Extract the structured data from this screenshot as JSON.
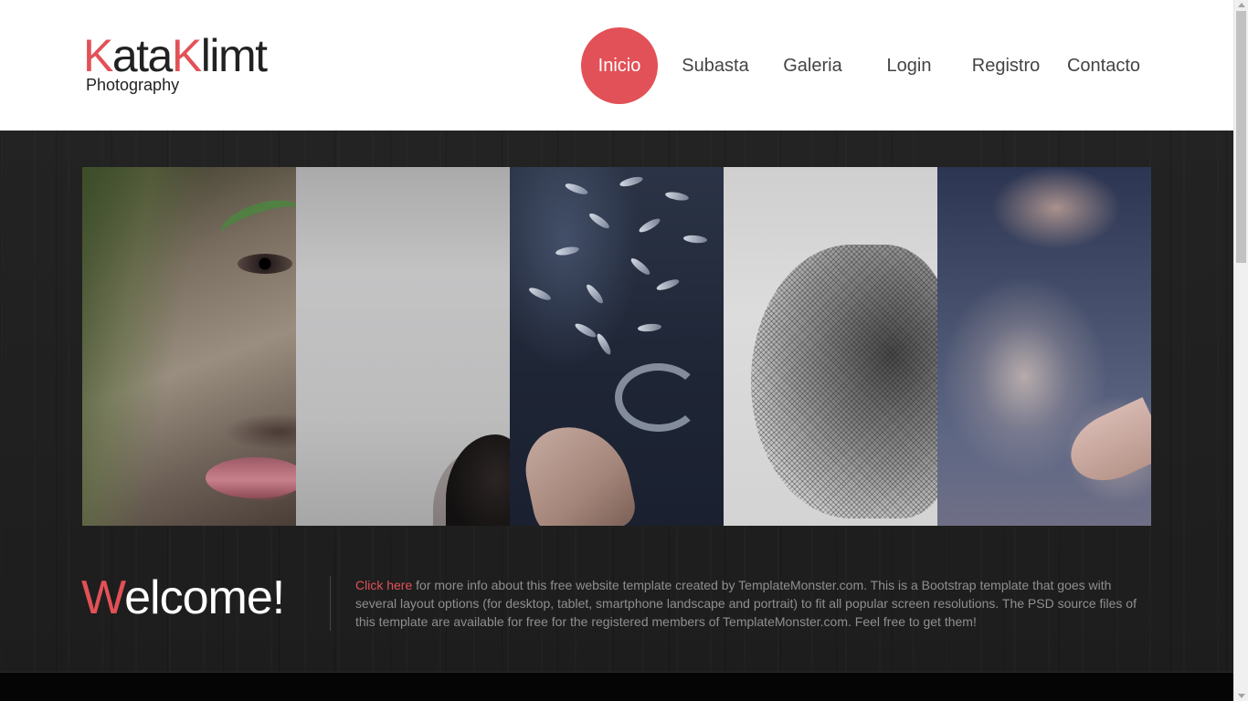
{
  "logo": {
    "first_initial": "K",
    "first_rest": "ata",
    "second_initial": "K",
    "second_rest": "limt",
    "subtitle": "Photography"
  },
  "nav": {
    "items": [
      {
        "label": "Inicio",
        "active": true
      },
      {
        "label": "Subasta",
        "active": false
      },
      {
        "label": "Galeria",
        "active": false
      },
      {
        "label": "Login",
        "active": false
      },
      {
        "label": "Registro",
        "active": false
      },
      {
        "label": "Contacto",
        "active": false
      }
    ]
  },
  "welcome": {
    "initial": "W",
    "rest": "elcome!"
  },
  "intro": {
    "link_text": "Click here",
    "body_text": " for more info about this free website template created by TemplateMonster.com. This is a Bootstrap template that goes with several layout options (for desktop, tablet, smartphone landscape and portrait) to fit all popular screen resolutions. The PSD source files of this template are available for free for the registered members of TemplateMonster.com. Feel free to get them!"
  },
  "colors": {
    "accent": "#e25157",
    "header_bg": "#ffffff",
    "main_bg": "#1f1f1f",
    "text_muted": "#8f8f8f"
  }
}
